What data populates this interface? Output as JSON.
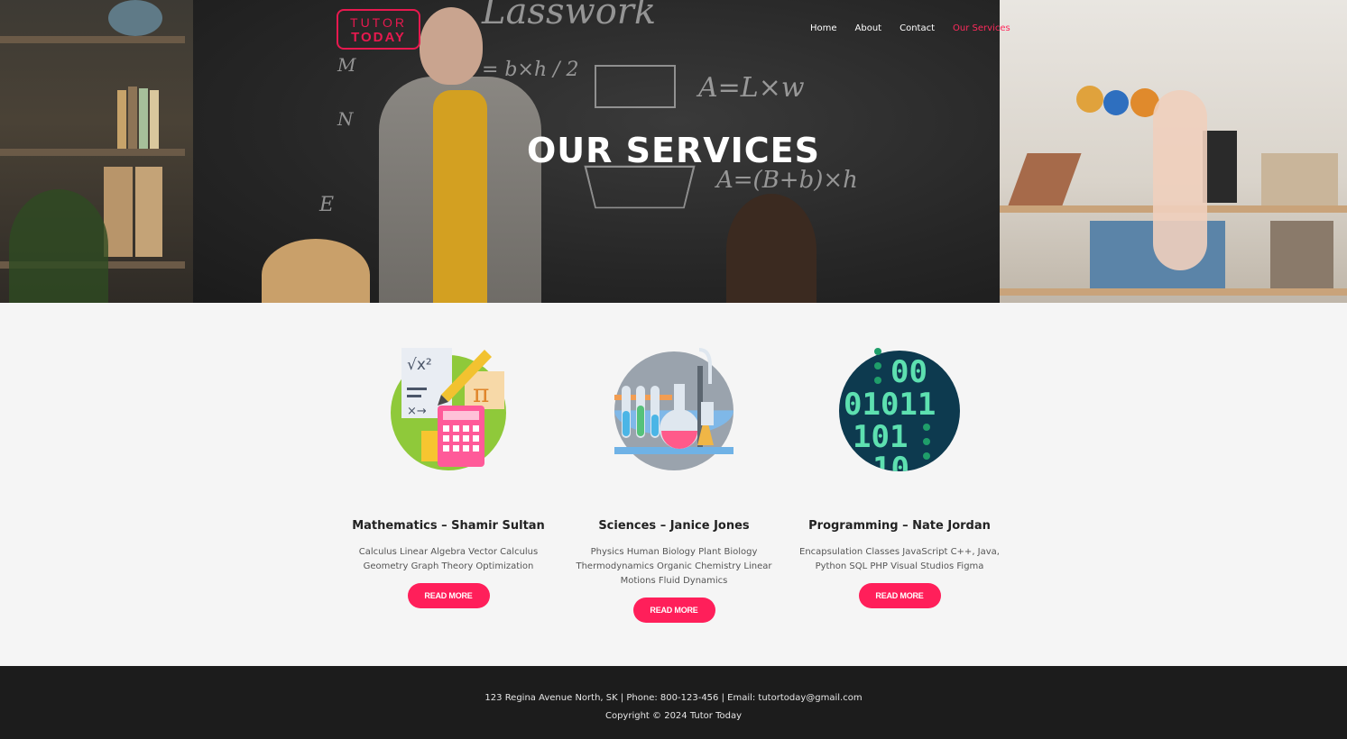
{
  "brand": {
    "line1": "TUTOR",
    "line2": "TODAY"
  },
  "nav": {
    "items": [
      {
        "label": "Home"
      },
      {
        "label": "About"
      },
      {
        "label": "Contact"
      },
      {
        "label": "Our Services"
      }
    ],
    "active_color": "#ff2a5c"
  },
  "hero": {
    "title": "OUR SERVICES"
  },
  "services": [
    {
      "title": "Mathematics – Shamir Sultan",
      "description": "Calculus Linear Algebra Vector Calculus Geometry Graph Theory Optimization",
      "button": "READ MORE",
      "icon": "math-icon"
    },
    {
      "title": "Sciences – Janice Jones",
      "description": "Physics Human Biology Plant Biology Thermodynamics Organic Chemistry Linear Motions Fluid Dynamics",
      "button": "READ MORE",
      "icon": "lab-flask-icon"
    },
    {
      "title": "Programming – Nate Jordan",
      "description": "Encapsulation Classes JavaScript C++, Java, Python SQL PHP Visual Studios Figma",
      "button": "READ MORE",
      "icon": "binary-code-icon"
    }
  ],
  "footer": {
    "contact": "123 Regina Avenue North, SK | Phone: 800-123-456 | Email: tutortoday@gmail.com",
    "copyright": "Copyright © 2024 Tutor Today"
  },
  "colors": {
    "accent": "#ff1f5a",
    "footer_bg": "#1c1c1c",
    "body_bg": "#f5f5f5"
  }
}
